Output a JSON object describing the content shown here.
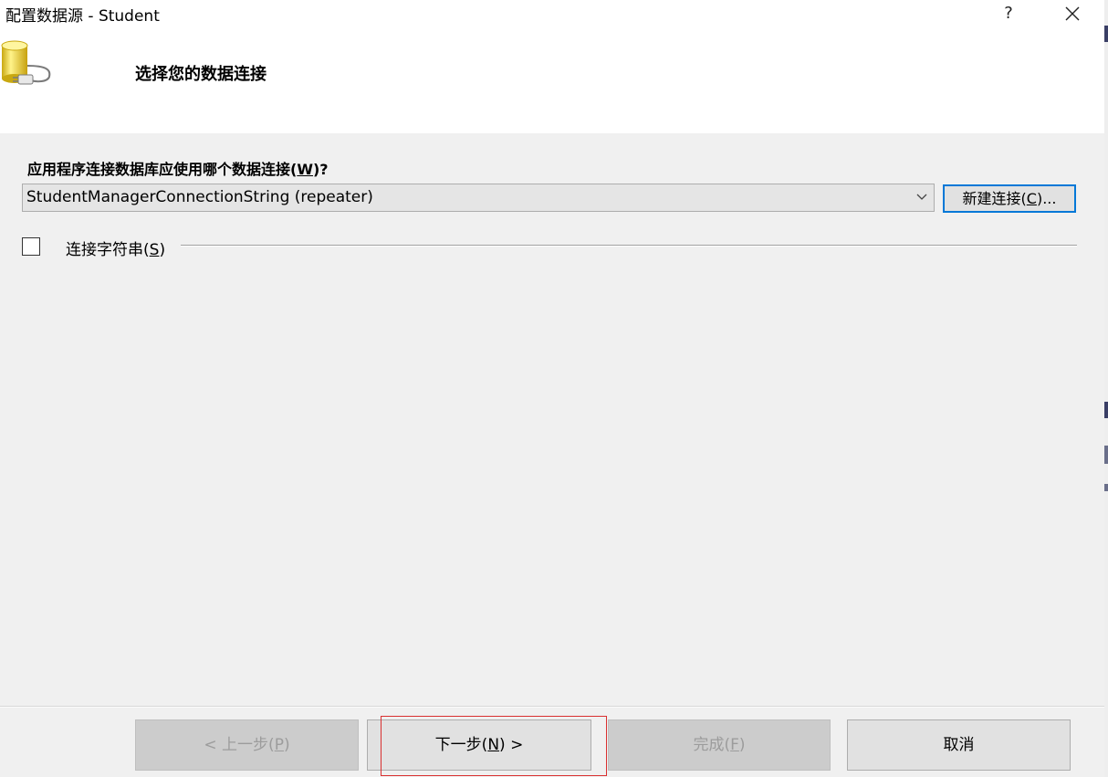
{
  "window": {
    "title": "配置数据源 - Student",
    "help_label": "?"
  },
  "header": {
    "title": "选择您的数据连接"
  },
  "connection": {
    "question_prefix": "应用程序连接数据库应使用哪个数据连接(",
    "question_key": "W",
    "question_suffix": ")?",
    "selected_value": "StudentManagerConnectionString (repeater)",
    "new_connection_prefix": "新建连接(",
    "new_connection_key": "C",
    "new_connection_suffix": ")..."
  },
  "connection_string": {
    "label_prefix": "连接字符串(",
    "label_key": "S",
    "label_suffix": ")",
    "checked": false
  },
  "footer": {
    "prev_prefix": "< 上一步(",
    "prev_key": "P",
    "prev_suffix": ")",
    "next_prefix": "下一步(",
    "next_key": "N",
    "next_suffix": ") >",
    "finish_prefix": "完成(",
    "finish_key": "F",
    "finish_suffix": ")",
    "cancel_label": "取消"
  },
  "colors": {
    "focus_border": "#0078d7",
    "highlight_outline": "#d93030",
    "header_bg": "#ffffff",
    "body_bg": "#f0f0f0"
  }
}
